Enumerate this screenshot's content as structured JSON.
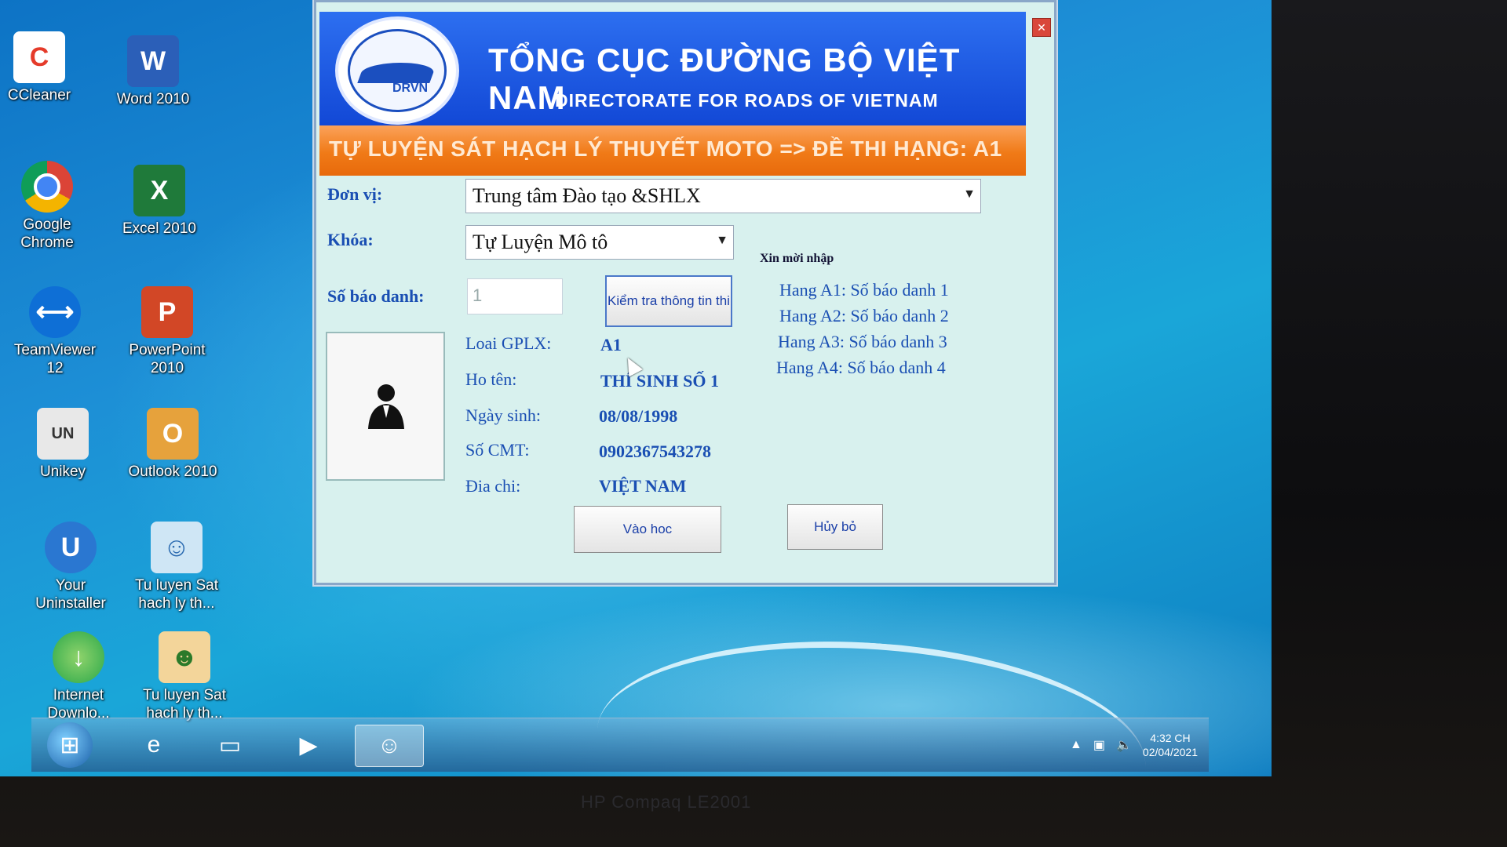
{
  "desktop": {
    "icons": [
      {
        "label": "CCleaner",
        "icon": "ccleaner-icon",
        "color": "#e53b2a"
      },
      {
        "label": "Word 2010",
        "icon": "word-icon",
        "color": "#2b5fb8"
      },
      {
        "label": "Google Chrome",
        "icon": "chrome-icon",
        "color": "#db4437"
      },
      {
        "label": "Excel 2010",
        "icon": "excel-icon",
        "color": "#1f7a3a"
      },
      {
        "label": "TeamViewer 12",
        "icon": "teamviewer-icon",
        "color": "#0e6fd6"
      },
      {
        "label": "PowerPoint 2010",
        "icon": "powerpoint-icon",
        "color": "#d24726"
      },
      {
        "label": "Unikey",
        "icon": "unikey-icon",
        "color": "#d9d9d9"
      },
      {
        "label": "Outlook 2010",
        "icon": "outlook-icon",
        "color": "#e6a23c"
      },
      {
        "label": "Your Uninstaller",
        "icon": "uninstaller-icon",
        "color": "#2a77d1"
      },
      {
        "label": "Tu luyen Sat hach ly th...",
        "icon": "exam-app-icon",
        "color": "#5aa0d8"
      },
      {
        "label": "Internet Downlo...",
        "icon": "idm-icon",
        "color": "#2aa84a"
      },
      {
        "label": "Tu luyen Sat hach ly th...",
        "icon": "driver-app-icon",
        "color": "#e0a34a"
      }
    ]
  },
  "dialog": {
    "org_title": "TỔNG CỤC ĐƯỜNG BỘ VIỆT NAM",
    "org_subtitle": "DIRECTORATE FOR ROADS OF VIETNAM",
    "logo_text": "DRVN",
    "exam_title": "TỰ LUYỆN SÁT HẠCH LÝ THUYẾT  MOTO => ĐỀ THI HẠNG: A1",
    "don_vi_label": "Đơn vị:",
    "don_vi_value": "Trung tâm Đào tạo &SHLX",
    "khoa_label": "Khóa:",
    "khoa_value": "Tự Luyện Mô tô",
    "sbd_label": "Số báo danh:",
    "sbd_value": "1",
    "check_button": "Kiểm tra thông tin thi",
    "hint_title": "Xin mời nhập",
    "hints": [
      "Hang A1: Số báo danh 1",
      "Hang A2: Số báo danh 2",
      "Hang A3: Số báo danh 3",
      "Hang A4: Số báo danh 4"
    ],
    "info": {
      "loai_label": "Loai GPLX:",
      "loai_value": "A1",
      "hoten_label": "Ho tên:",
      "hoten_value": "THÍ SINH SỐ 1",
      "ngaysinh_label": "Ngày sinh:",
      "ngaysinh_value": "08/08/1998",
      "cmt_label": "Số CMT:",
      "cmt_value": "0902367543278",
      "diachi_label": "Đia chi:",
      "diachi_value": "VIỆT NAM"
    },
    "enter_button": "Vào hoc",
    "cancel_button": "Hủy bỏ"
  },
  "taskbar": {
    "clock_time": "4:32 CH",
    "clock_date": "02/04/2021"
  },
  "monitor_brand": "HP Compaq LE2001",
  "colors": {
    "accent_blue": "#1248d6",
    "orange_bar": "#f07a17",
    "label_blue": "#1a4fb3"
  }
}
